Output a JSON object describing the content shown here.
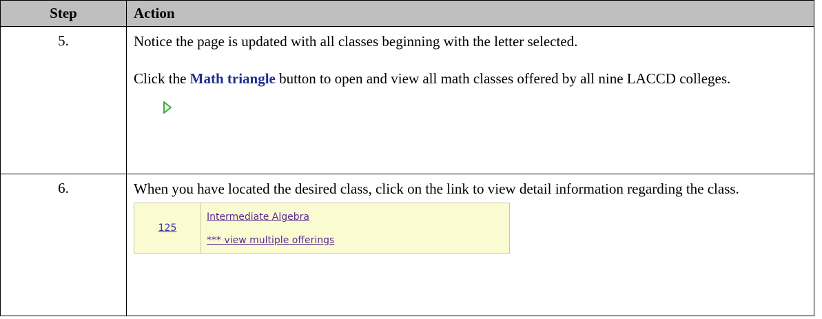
{
  "header": {
    "step": "Step",
    "action": "Action"
  },
  "rows": [
    {
      "step": "5.",
      "para1": "Notice the page is updated with all classes beginning with the letter selected.",
      "para2_pre": "Click the ",
      "para2_highlight": "Math triangle",
      "para2_post": " button to open and view all math classes offered by all nine LACCD colleges.",
      "icon": "expand-triangle-icon",
      "icon_color": "#3fae3f"
    },
    {
      "step": "6.",
      "para1": "When you have located the desired class, click on the link to view detail information regarding the class.",
      "class_number": "125",
      "class_title": "Intermediate Algebra",
      "class_offerings": "*** view multiple offerings"
    }
  ],
  "colors": {
    "header_bg": "#bfbfbf",
    "highlight": "#1f2f8f",
    "snip_bg": "#fbfbd2"
  }
}
